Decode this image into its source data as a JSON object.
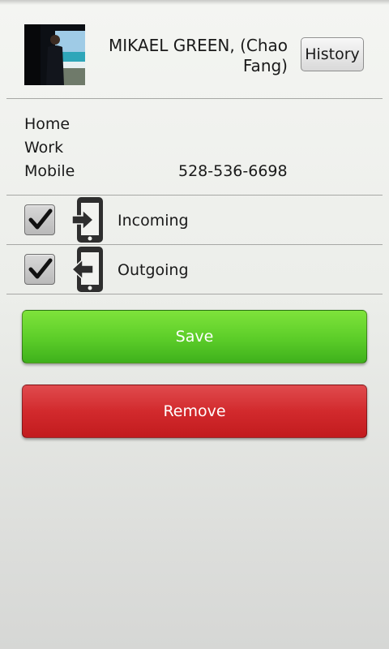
{
  "contact": {
    "name": "MIKAEL GREEN, (Chao Fang)",
    "photo_icon": "contact-photo"
  },
  "header": {
    "history_label": "History"
  },
  "phones": [
    {
      "label": "Home",
      "number": ""
    },
    {
      "label": "Work",
      "number": ""
    },
    {
      "label": "Mobile",
      "number": "528-536-6698"
    }
  ],
  "filters": [
    {
      "label": "Incoming",
      "checked": true,
      "icon": "incoming-call-icon"
    },
    {
      "label": "Outgoing",
      "checked": true,
      "icon": "outgoing-call-icon"
    }
  ],
  "actions": {
    "save_label": "Save",
    "remove_label": "Remove"
  },
  "colors": {
    "save": "#5fcf2a",
    "remove": "#d22a2d",
    "icon": "#2e2e2e"
  }
}
